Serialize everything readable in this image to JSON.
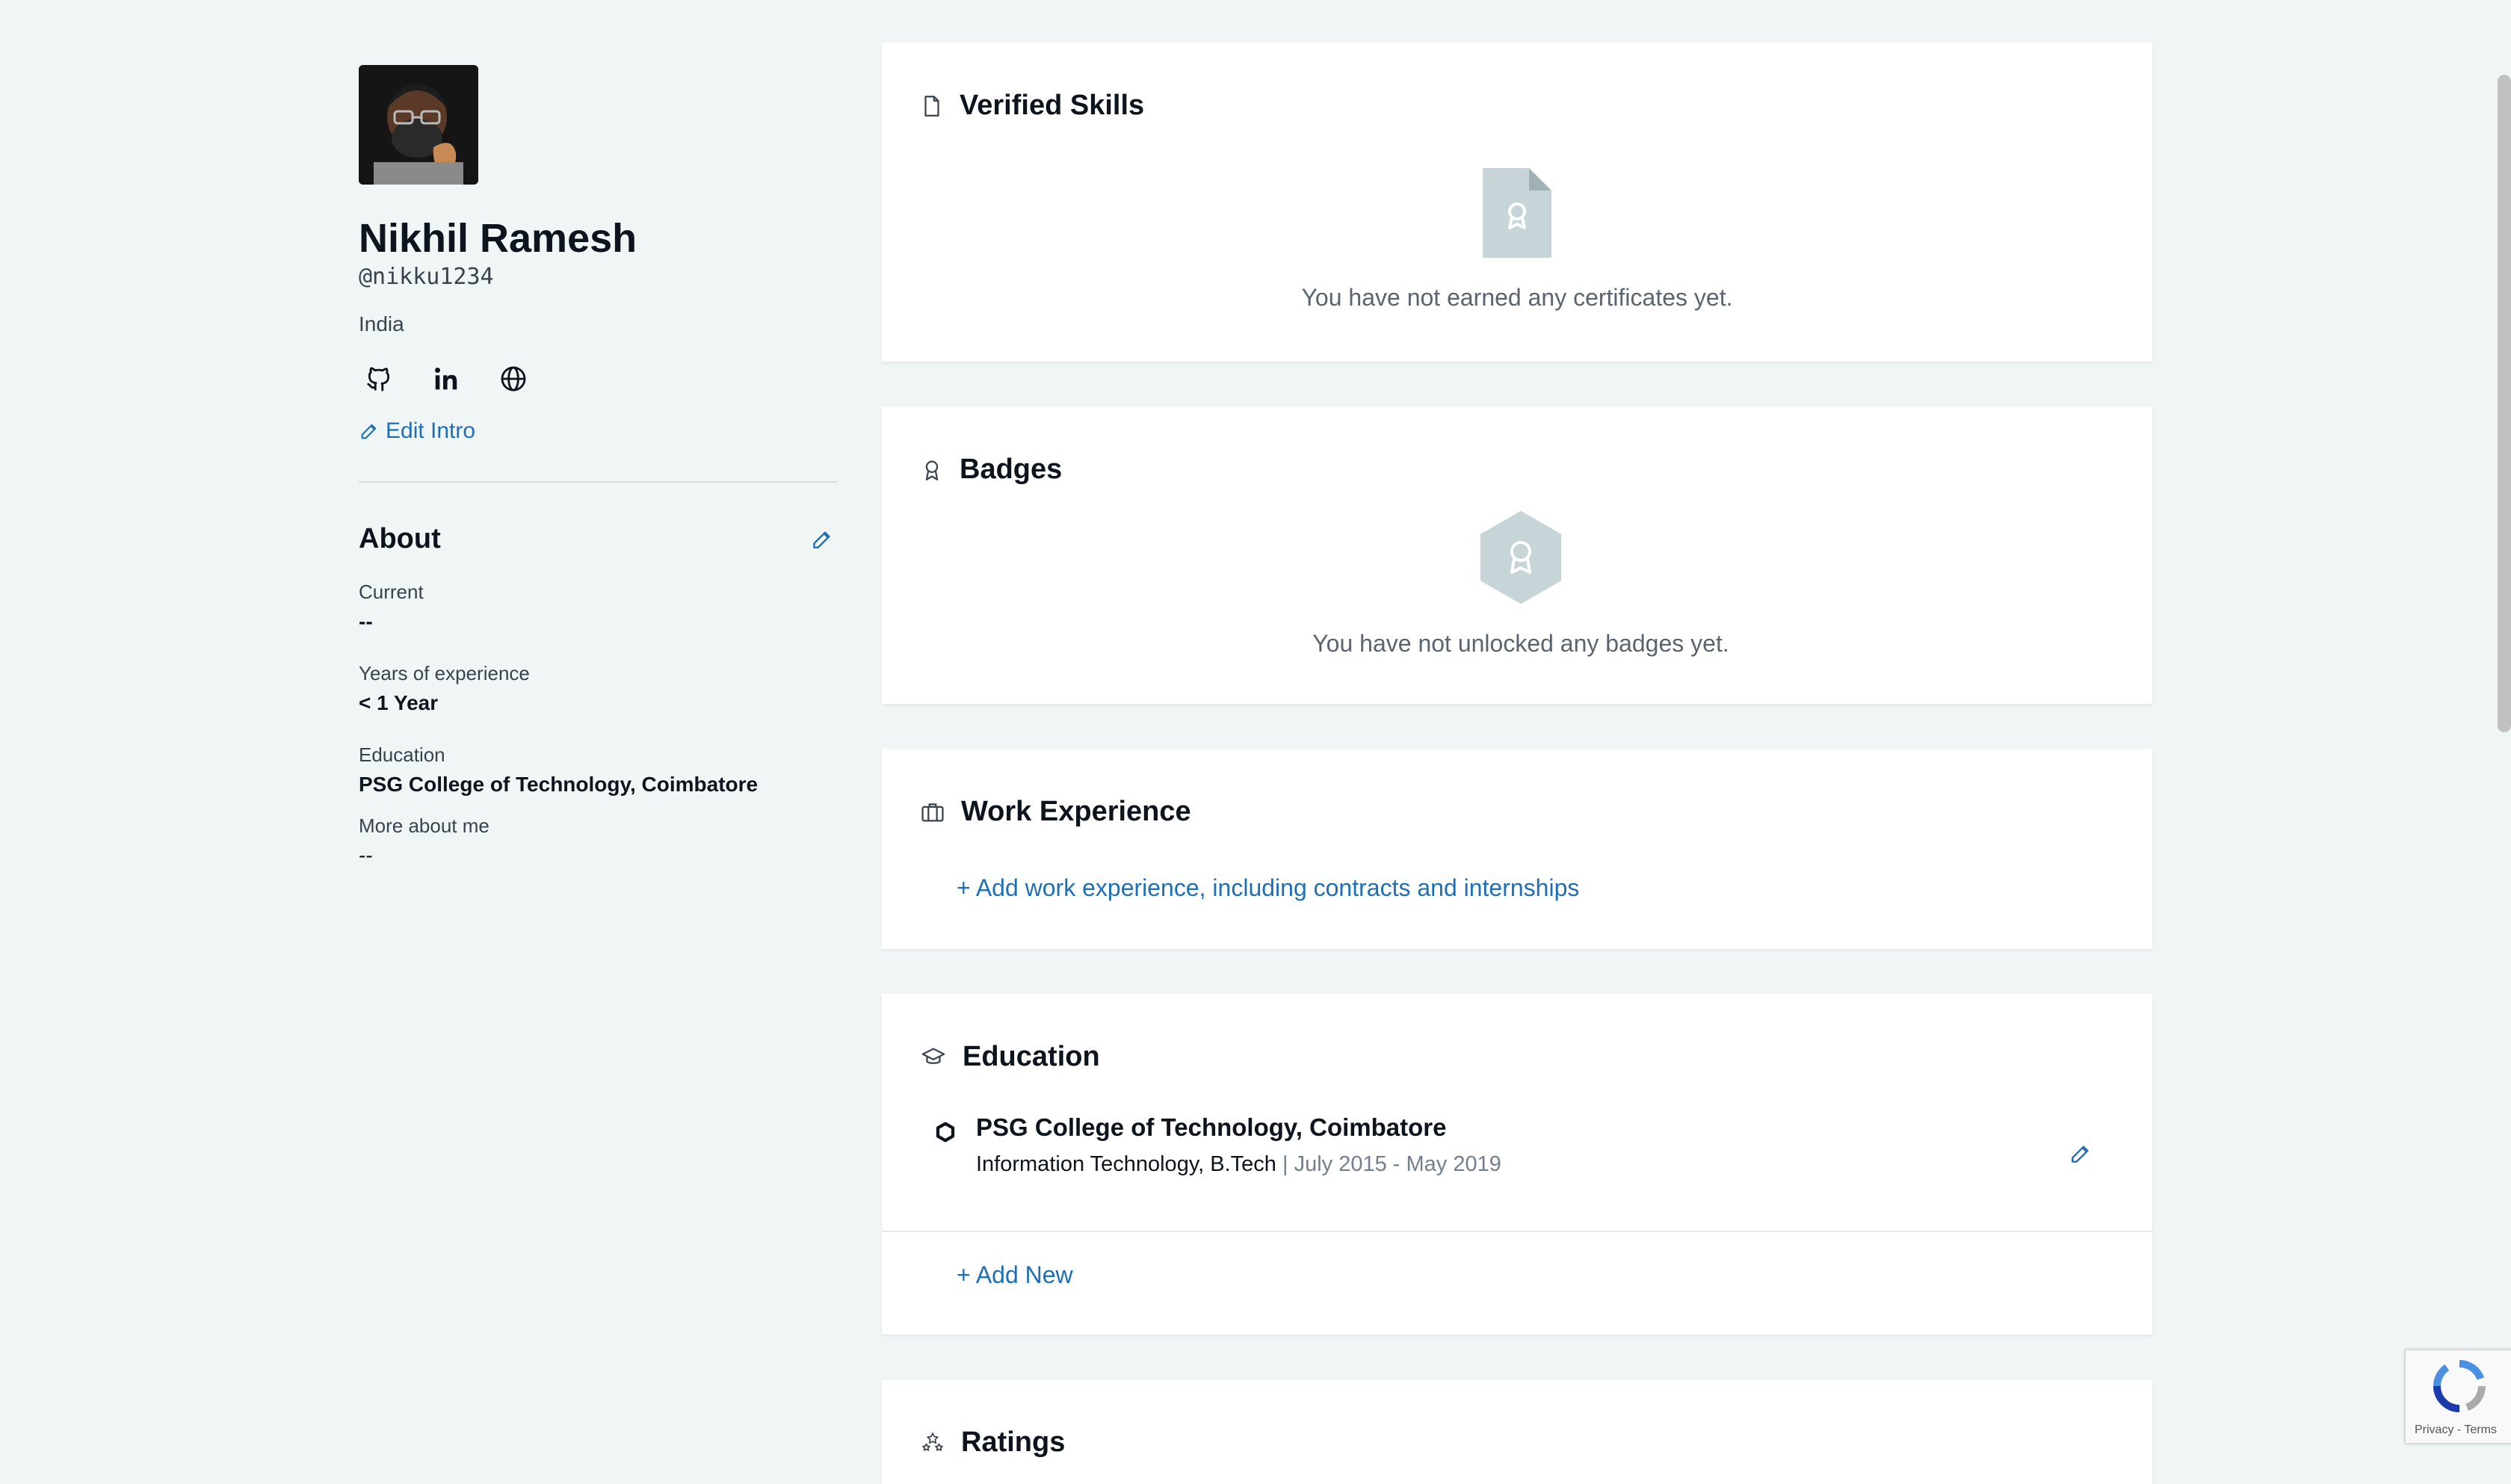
{
  "profile": {
    "name": "Nikhil Ramesh",
    "handle": "@nikku1234",
    "country": "India",
    "edit_intro": "Edit Intro"
  },
  "about": {
    "title": "About",
    "fields": [
      {
        "label": "Current",
        "value": "--"
      },
      {
        "label": "Years of experience",
        "value": "< 1 Year"
      },
      {
        "label": "Education",
        "value": "PSG College of Technology, Coimbatore"
      },
      {
        "label": "More about me",
        "value": "--"
      }
    ]
  },
  "sections": {
    "verified_skills": {
      "title": "Verified Skills",
      "empty": "You have not earned any certificates yet."
    },
    "badges": {
      "title": "Badges",
      "empty": "You have not unlocked any badges yet."
    },
    "work": {
      "title": "Work Experience",
      "add": "+ Add work experience, including contracts and internships"
    },
    "education": {
      "title": "Education",
      "item": {
        "school": "PSG College of Technology, Coimbatore",
        "degree": "Information Technology, B.Tech",
        "dates": "July 2015 - May 2019"
      },
      "add": "+ Add New"
    },
    "ratings": {
      "title": "Ratings"
    }
  },
  "recaptcha": {
    "text": "Privacy - Terms"
  },
  "colors": {
    "accent": "#1f6fb5",
    "background": "#f0f5f5",
    "icon_gray": "#c7d5d8"
  }
}
